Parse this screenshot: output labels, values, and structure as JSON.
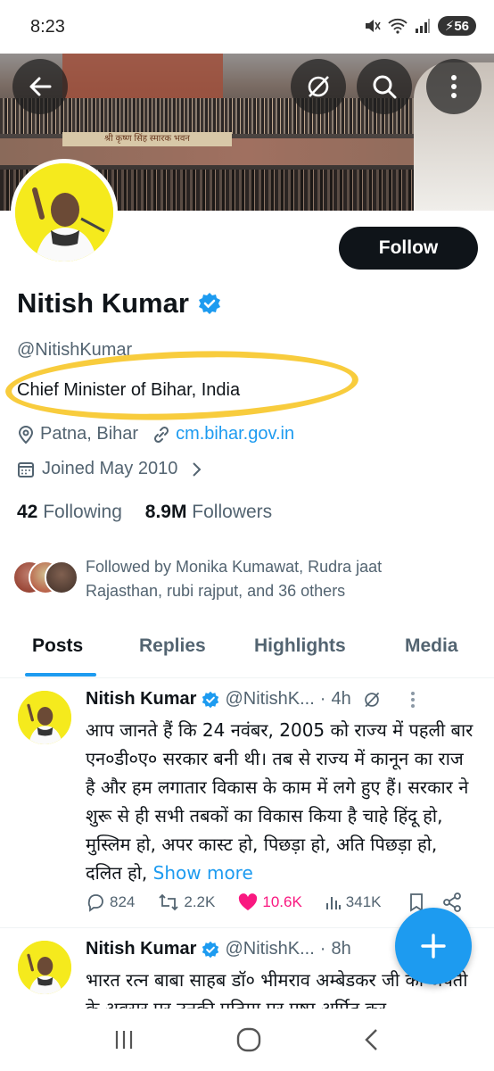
{
  "status_bar": {
    "time": "8:23",
    "battery": "56"
  },
  "banner": {
    "sign_text": "श्री कृष्ण सिंह स्मारक भवन"
  },
  "profile": {
    "name": "Nitish Kumar",
    "handle": "@NitishKumar",
    "bio": "Chief Minister of Bihar, India",
    "location": "Patna, Bihar",
    "website": "cm.bihar.gov.in",
    "joined": "Joined May 2010",
    "following_count": "42",
    "following_label": "Following",
    "followers_count": "8.9M",
    "followers_label": "Followers",
    "followed_by": "Followed by Monika Kumawat, Rudra jaat Rajasthan, rubi rajput, and 36 others",
    "follow_button": "Follow"
  },
  "tabs": [
    "Posts",
    "Replies",
    "Highlights",
    "Media"
  ],
  "active_tab": "Posts",
  "tweets": [
    {
      "name": "Nitish Kumar",
      "handle": "@NitishK...",
      "dot": "·",
      "time": "4h",
      "body": "आप जानते हैं कि 24 नवंबर, 2005 को राज्य में पहली बार एन०डी०ए० सरकार बनी थी। तब से राज्य में कानून का राज है और हम लगातार विकास के काम में लगे हुए हैं। सरकार ने शुरू से ही सभी तबकों का विकास किया है चाहे हिंदू हो, मुस्लिम हो, अपर कास्ट हो, पिछड़ा हो, अति पिछड़ा हो, दलित हो,",
      "show_more": "Show more",
      "replies": "824",
      "reposts": "2.2K",
      "likes": "10.6K",
      "views": "341K"
    },
    {
      "name": "Nitish Kumar",
      "handle": "@NitishK...",
      "dot": "·",
      "time": "8h",
      "body": "भारत रत्न बाबा साहब डॉ० भीमराव अम्बेडकर जी की जयंती के अवसर पर उनकी प्रतिमा पर पुष्प अर्पित कर"
    }
  ],
  "colors": {
    "accent": "#1d9bf0",
    "like": "#f91880",
    "highlight": "#f7c628",
    "avatar_bg": "#f5ea1d"
  }
}
